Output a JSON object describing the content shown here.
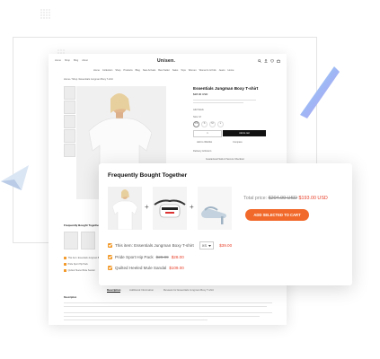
{
  "store": {
    "logo": "Unisen.",
    "top_links": [
      "Home",
      "Shop",
      "Blog",
      "About"
    ],
    "nav": [
      "Home",
      "Collection",
      "Shop",
      "Products",
      "Blog",
      "New Arrivals",
      "Best Seller",
      "Sales",
      "Tops",
      "Women",
      "Women's & Kids",
      "Jeans",
      "Home"
    ],
    "breadcrumb": "Home / Shop / Essentials Jungman Boxy T-shirt"
  },
  "product": {
    "title": "Essentials Jungman Boxy T-shirt",
    "price": "$28.00 USD",
    "stock_label": "Add Stock",
    "size_label": "Size: M",
    "sizes": [
      "XS",
      "S",
      "M",
      "L"
    ],
    "qty": "1",
    "add_to_cart": "Add to cart",
    "wishlist": "Add to Wishlist",
    "compare": "Compare",
    "delivery": "Delivery & Return",
    "guarantee": "Guaranteed Safe & Secure Checkout"
  },
  "small_fbt": {
    "title": "Frequently Bought Together",
    "items": [
      "This Item: Essentials Jungman Boxy",
      "Pride Sport Hip Pack",
      "Quilted Heeled Mule Sandal"
    ]
  },
  "tabs": [
    "Description",
    "Additional Information",
    "Reviews for Essentials Jungman Boxy T-shirt"
  ],
  "description_heading": "Description",
  "fbt": {
    "title": "Frequently Bought Together",
    "total_label": "Total price:",
    "total_old": "$204.99 USD",
    "total_new": "$193.00 USD",
    "add_button": "ADD SELECTED TO CART",
    "items": [
      {
        "label": "This item: Essentials Jungman Boxy T-shirt",
        "size": "XS",
        "old": "",
        "price": "$39.00"
      },
      {
        "label": "Pride Sport Hip Pack",
        "size": "",
        "old": "$29.99",
        "price": "$28.00"
      },
      {
        "label": "Quilted Heeled Mule Sandal",
        "size": "",
        "old": "",
        "price": "$109.00"
      }
    ]
  },
  "colors": {
    "accent": "#f26a2b",
    "sale": "#e8412b",
    "check": "#f29a2b",
    "brand": "#111111"
  }
}
